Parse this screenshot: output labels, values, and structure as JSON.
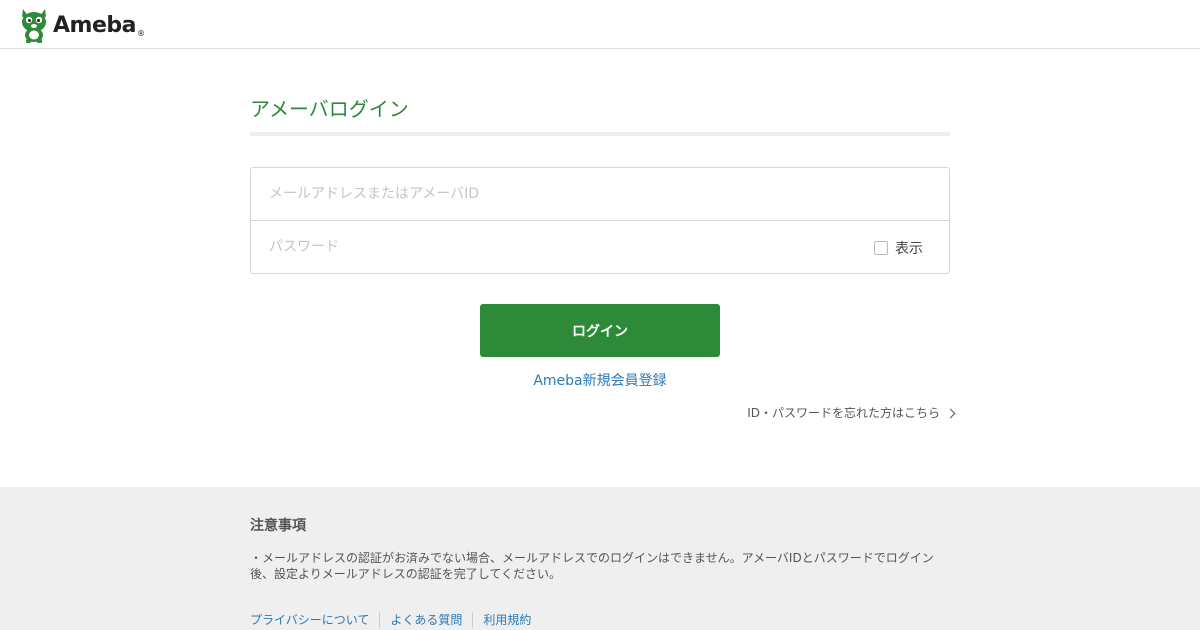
{
  "header": {
    "logo_text": "Ameba",
    "logo_mark": "®",
    "logo_icon": "ameba-mascot-icon"
  },
  "main": {
    "title": "アメーバログイン",
    "email_placeholder": "メールアドレスまたはアメーバID",
    "password_placeholder": "パスワード",
    "show_password_label": "表示",
    "login_button_label": "ログイン",
    "register_link": "Ameba新規会員登録",
    "forgot_link": "ID・パスワードを忘れた方はこちら"
  },
  "footer": {
    "notice_title": "注意事項",
    "notice_line1": "・メールアドレスの認証がお済みでない場合、メールアドレスでのログインはできません。アメーバIDとパスワードでログイン",
    "notice_line2": "後、設定よりメールアドレスの認証を完了してください。",
    "links": [
      {
        "label": "プライバシーについて"
      },
      {
        "label": "よくある質問"
      },
      {
        "label": "利用規約"
      }
    ]
  },
  "colors": {
    "brand_green": "#2d8a39",
    "link_blue": "#2a7ab8",
    "footer_bg": "#efefef"
  }
}
